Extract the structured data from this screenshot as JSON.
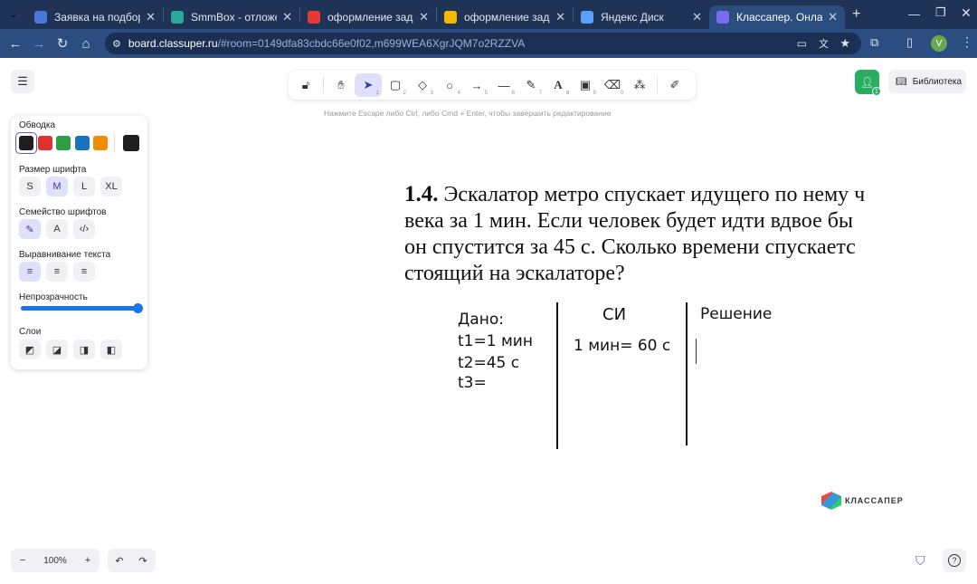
{
  "browser": {
    "tabs": [
      {
        "title": "Заявка на подбор сп",
        "fav": "#4a78d6",
        "active": false
      },
      {
        "title": "SmmBox - отложенны",
        "fav": "#2aa89a",
        "active": false
      },
      {
        "title": "оформление задачи",
        "fav": "#e53935",
        "active": false
      },
      {
        "title": "оформление задачи",
        "fav": "#f5b800",
        "active": false
      },
      {
        "title": "Яндекс Диск",
        "fav": "#5aa0ff",
        "active": false
      },
      {
        "title": "Классапер. Онлайн д",
        "fav": "#7a6cf0",
        "active": true
      }
    ],
    "url_host": "board.classuper.ru",
    "url_path": "/#room=0149dfa83cbdc66e0f02,m699WEA6XgrJQM7o2RZZVA",
    "profile_letter": "V"
  },
  "panel": {
    "stroke_label": "Обводка",
    "stroke_colors": [
      "#1e1e1e",
      "#e03131",
      "#2f9e44",
      "#1971c2",
      "#f08c00"
    ],
    "stroke_current": "#1e1e1e",
    "font_size_label": "Размер шрифта",
    "font_sizes": [
      "S",
      "M",
      "L",
      "XL"
    ],
    "font_family_label": "Семейство шрифтов",
    "font_family_glyph_2": "A",
    "align_label": "Выравнивание текста",
    "opacity_label": "Непрозрачность",
    "opacity": 1.0,
    "layers_label": "Слои"
  },
  "toolbar": {
    "tool_keys": [
      "1",
      "2",
      "3",
      "4",
      "5",
      "6",
      "7",
      "8",
      "9",
      "0"
    ]
  },
  "hint": "Нажмите Escape либо Ctrl, либо Cmd + Enter, чтобы завершить редактирование",
  "library_label": "Библиотека",
  "collaborators_count": "1",
  "problem": {
    "number": "1.4.",
    "line1": " Эскалатор метро спускает идущего по нему ч",
    "line2": "века за 1 мин. Если человек будет идти вдвое бы",
    "line3": "он спустится за 45 с. Сколько времени спускаетс",
    "line4": "стоящий на эскалаторе?"
  },
  "handwriting": {
    "given": [
      "Дано:",
      "t1=1 мин",
      "t2=45 с",
      "t3="
    ],
    "si_header": "СИ",
    "si_value": "1 мин= 60 с",
    "solution_header": "Решение"
  },
  "bottom": {
    "zoom": "100%",
    "zoom_out": "−",
    "zoom_in": "+",
    "undo": "↶",
    "redo": "↷",
    "brand": "КЛАССАПЕР",
    "help": "?"
  }
}
